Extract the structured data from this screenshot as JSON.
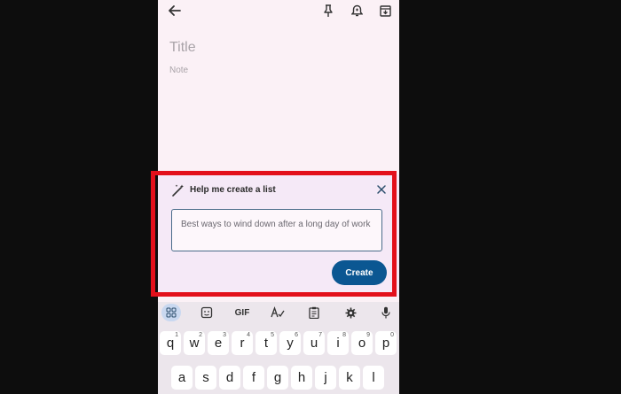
{
  "app": {
    "title_placeholder": "Title",
    "note_placeholder": "Note"
  },
  "topbar": {
    "icons": [
      "back-arrow-icon",
      "pin-icon",
      "reminder-icon",
      "archive-icon"
    ]
  },
  "panel": {
    "title": "Help me create a list",
    "prompt_text": "Best ways to wind down after a long day of work",
    "create_label": "Create"
  },
  "keyboard": {
    "toolbar": {
      "gif_label": "GIF",
      "icons": [
        "apps-grid-icon",
        "sticker-icon",
        "gif-icon",
        "handwriting-icon",
        "clipboard-icon",
        "settings-gear-icon",
        "microphone-icon"
      ]
    },
    "row1": [
      {
        "key": "q",
        "num": "1"
      },
      {
        "key": "w",
        "num": "2"
      },
      {
        "key": "e",
        "num": "3"
      },
      {
        "key": "r",
        "num": "4"
      },
      {
        "key": "t",
        "num": "5"
      },
      {
        "key": "y",
        "num": "6"
      },
      {
        "key": "u",
        "num": "7"
      },
      {
        "key": "i",
        "num": "8"
      },
      {
        "key": "o",
        "num": "9"
      },
      {
        "key": "p",
        "num": "0"
      }
    ],
    "row2": [
      "a",
      "s",
      "d",
      "f",
      "g",
      "h",
      "j",
      "k",
      "l"
    ]
  },
  "colors": {
    "accent": "#0b5792",
    "highlight_border": "#e3101b",
    "panel_bg": "#f5e9f7",
    "note_bg": "#fbf1f6"
  }
}
